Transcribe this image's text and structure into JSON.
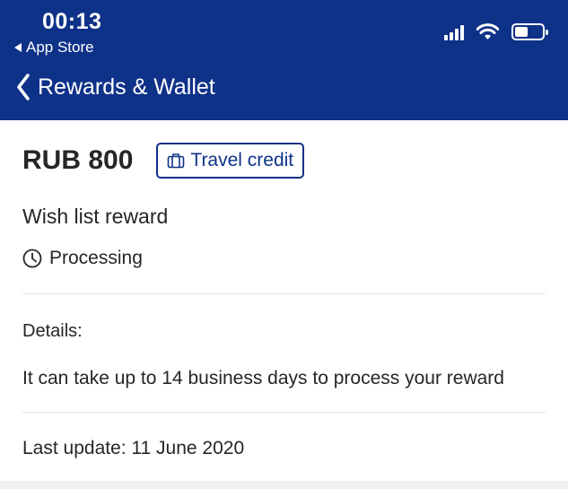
{
  "status_bar": {
    "time": "00:13",
    "back_app": "App Store",
    "icons": [
      "signal-icon",
      "wifi-icon",
      "battery-icon"
    ]
  },
  "nav": {
    "title": "Rewards & Wallet",
    "back_icon": "chevron-left-icon"
  },
  "reward": {
    "amount": "RUB 800",
    "badge_label": "Travel credit",
    "badge_icon": "suitcase-icon",
    "name": "Wish list reward",
    "status": "Processing",
    "status_icon": "clock-icon"
  },
  "details": {
    "label": "Details:",
    "text": "It can take up to 14 business days to process your reward"
  },
  "last_update": "Last update: 11 June 2020",
  "colors": {
    "header": "#0f3289",
    "accent": "#0f3289",
    "text": "#262626",
    "divider": "#e4e4e4"
  }
}
